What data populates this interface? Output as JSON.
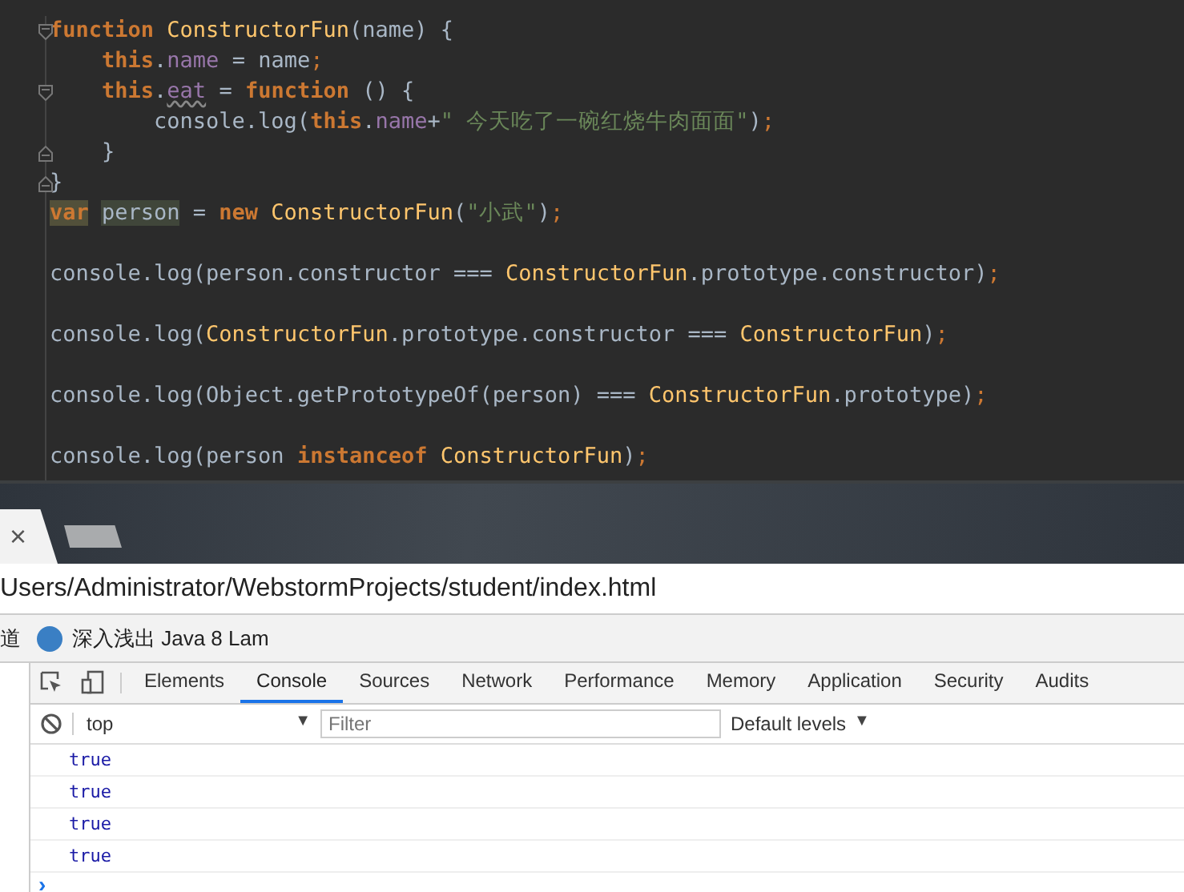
{
  "editor": {
    "lines": [
      {
        "kind": "fold-start",
        "tokens": [
          {
            "text": "function ",
            "kind": "kw"
          },
          {
            "text": "ConstructorFun",
            "kind": "fn"
          },
          {
            "text": "(name) {",
            "kind": "plain"
          }
        ]
      },
      {
        "kind": "plain",
        "tokens": [
          {
            "text": "    this",
            "kind": "kw"
          },
          {
            "text": ".",
            "kind": "plain"
          },
          {
            "text": "name",
            "kind": "prop"
          },
          {
            "text": " = name",
            "kind": "plain"
          },
          {
            "text": ";",
            "kind": "semi"
          }
        ]
      },
      {
        "kind": "fold-start",
        "tokens": [
          {
            "text": "    this",
            "kind": "kw"
          },
          {
            "text": ".",
            "kind": "plain"
          },
          {
            "text": "eat",
            "kind": "warn"
          },
          {
            "text": " = ",
            "kind": "plain"
          },
          {
            "text": "function",
            "kind": "kw"
          },
          {
            "text": " () {",
            "kind": "plain"
          }
        ]
      },
      {
        "kind": "plain",
        "tokens": [
          {
            "text": "        console.log(",
            "kind": "plain"
          },
          {
            "text": "this",
            "kind": "kw"
          },
          {
            "text": ".",
            "kind": "plain"
          },
          {
            "text": "name",
            "kind": "prop"
          },
          {
            "text": "+",
            "kind": "plain"
          },
          {
            "text": "\" 今天吃了一碗红烧牛肉面面\"",
            "kind": "str"
          },
          {
            "text": ")",
            "kind": "plain"
          },
          {
            "text": ";",
            "kind": "semi"
          }
        ]
      },
      {
        "kind": "fold-end",
        "tokens": [
          {
            "text": "    }",
            "kind": "plain"
          }
        ]
      },
      {
        "kind": "fold-end",
        "tokens": [
          {
            "text": "}",
            "kind": "plain"
          }
        ]
      },
      {
        "kind": "plain",
        "tokens": [
          {
            "text": "var",
            "kind": "kw-mark"
          },
          {
            "text": "person",
            "kind": "mark"
          },
          {
            "text": " = ",
            "kind": "plain"
          },
          {
            "text": "new ",
            "kind": "kw"
          },
          {
            "text": "ConstructorFun",
            "kind": "fn"
          },
          {
            "text": "(",
            "kind": "plain"
          },
          {
            "text": "\"小武\"",
            "kind": "str"
          },
          {
            "text": ")",
            "kind": "plain"
          },
          {
            "text": ";",
            "kind": "semi"
          }
        ]
      },
      {
        "kind": "blank"
      },
      {
        "kind": "plain",
        "tokens": [
          {
            "text": "console.log(person.constructor === ",
            "kind": "plain"
          },
          {
            "text": "ConstructorFun",
            "kind": "fn"
          },
          {
            "text": ".prototype.constructor)",
            "kind": "plain"
          },
          {
            "text": ";",
            "kind": "semi"
          }
        ]
      },
      {
        "kind": "blank"
      },
      {
        "kind": "plain",
        "tokens": [
          {
            "text": "console.log(",
            "kind": "plain"
          },
          {
            "text": "ConstructorFun",
            "kind": "fn"
          },
          {
            "text": ".prototype.constructor === ",
            "kind": "plain"
          },
          {
            "text": "ConstructorFun",
            "kind": "fn"
          },
          {
            "text": ")",
            "kind": "plain"
          },
          {
            "text": ";",
            "kind": "semi"
          }
        ]
      },
      {
        "kind": "blank"
      },
      {
        "kind": "plain",
        "tokens": [
          {
            "text": "console.log(Object.getPrototypeOf(person) === ",
            "kind": "plain"
          },
          {
            "text": "ConstructorFun",
            "kind": "fn"
          },
          {
            "text": ".prototype)",
            "kind": "plain"
          },
          {
            "text": ";",
            "kind": "semi"
          }
        ]
      },
      {
        "kind": "blank"
      },
      {
        "kind": "plain",
        "tokens": [
          {
            "text": "console.log(person ",
            "kind": "plain"
          },
          {
            "text": "instanceof ",
            "kind": "kw"
          },
          {
            "text": "ConstructorFun",
            "kind": "fn"
          },
          {
            "text": ")",
            "kind": "plain"
          },
          {
            "text": ";",
            "kind": "semi"
          }
        ]
      }
    ]
  },
  "browser": {
    "tabs": [
      {
        "close": "×",
        "selected": true
      },
      {
        "selected": false
      }
    ],
    "address": "Users/Administrator/WebstormProjects/student/index.html",
    "bookmarks": [
      {
        "label": "道",
        "icon": false
      },
      {
        "label": "深入浅出 Java 8 Lam",
        "icon": true
      }
    ]
  },
  "devtools": {
    "tabs": [
      {
        "label": "Elements",
        "selected": false
      },
      {
        "label": "Console",
        "selected": true
      },
      {
        "label": "Sources",
        "selected": false
      },
      {
        "label": "Network",
        "selected": false
      },
      {
        "label": "Performance",
        "selected": false
      },
      {
        "label": "Memory",
        "selected": false
      },
      {
        "label": "Application",
        "selected": false
      },
      {
        "label": "Security",
        "selected": false
      },
      {
        "label": "Audits",
        "selected": false
      }
    ],
    "context": "top",
    "context_caret": "▼",
    "filter": {
      "placeholder": "Filter"
    },
    "levels": "Default levels",
    "levels_caret": "▼",
    "messages": [
      "true",
      "true",
      "true",
      "true"
    ],
    "prompt": "›"
  }
}
